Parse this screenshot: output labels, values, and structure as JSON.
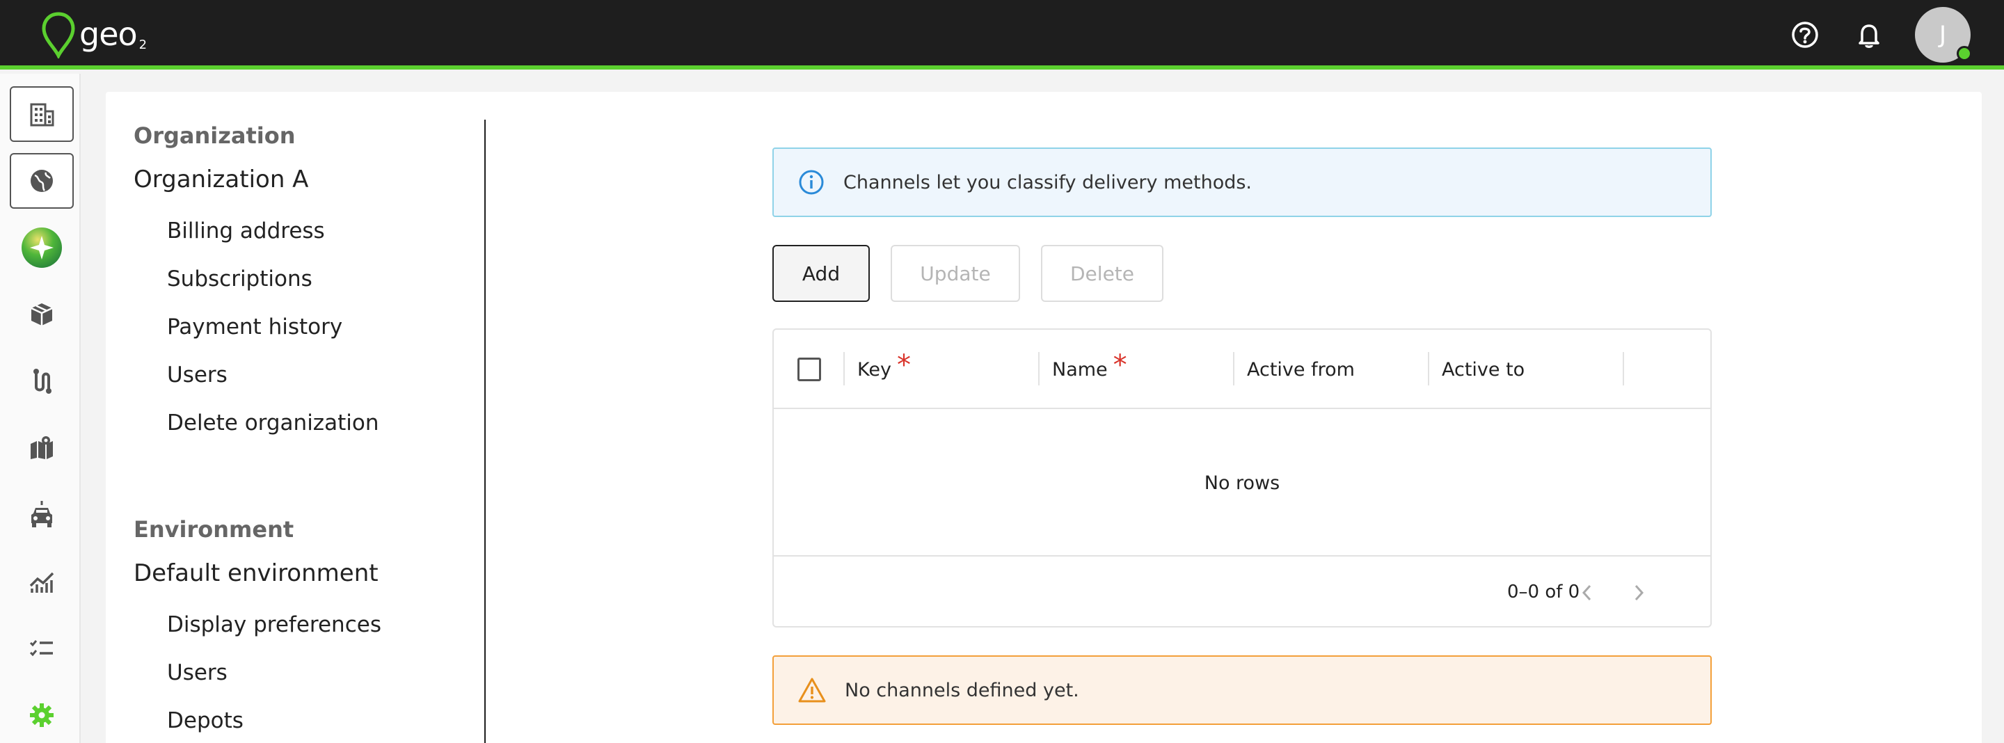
{
  "app": {
    "logo_text": "geo",
    "logo_sub": "2",
    "avatar_initial": "J",
    "accent_color": "#5bd02f"
  },
  "topbar_icons": [
    "help-icon",
    "bell-icon"
  ],
  "rail": {
    "items": [
      {
        "name": "building-icon",
        "boxed": true
      },
      {
        "name": "globe-icon",
        "boxed": true
      },
      {
        "name": "sparkle-ai-icon",
        "boxed": false
      },
      {
        "name": "package-icon",
        "boxed": false
      },
      {
        "name": "route-icon",
        "boxed": false
      },
      {
        "name": "map-icon",
        "boxed": false
      },
      {
        "name": "vehicle-icon",
        "boxed": false
      },
      {
        "name": "analytics-icon",
        "boxed": false
      },
      {
        "name": "checklist-icon",
        "boxed": false
      },
      {
        "name": "settings-gear-icon",
        "boxed": false,
        "active": true
      }
    ]
  },
  "nav": {
    "organization": {
      "section_label": "Organization",
      "name": "Organization A",
      "items": [
        "Billing address",
        "Subscriptions",
        "Payment history",
        "Users",
        "Delete organization"
      ]
    },
    "environment": {
      "section_label": "Environment",
      "name": "Default environment",
      "items": [
        "Display preferences",
        "Users",
        "Depots"
      ]
    }
  },
  "content": {
    "info_text": "Channels let you classify delivery methods.",
    "buttons": {
      "add": "Add",
      "update": "Update",
      "delete": "Delete"
    },
    "grid": {
      "columns": [
        {
          "label": "Key",
          "required": true
        },
        {
          "label": "Name",
          "required": true
        },
        {
          "label": "Active from",
          "required": false
        },
        {
          "label": "Active to",
          "required": false
        }
      ],
      "required_mark": "*",
      "empty_text": "No rows",
      "pagination": "0–0 of 0"
    },
    "warning_text": "No channels defined yet."
  }
}
